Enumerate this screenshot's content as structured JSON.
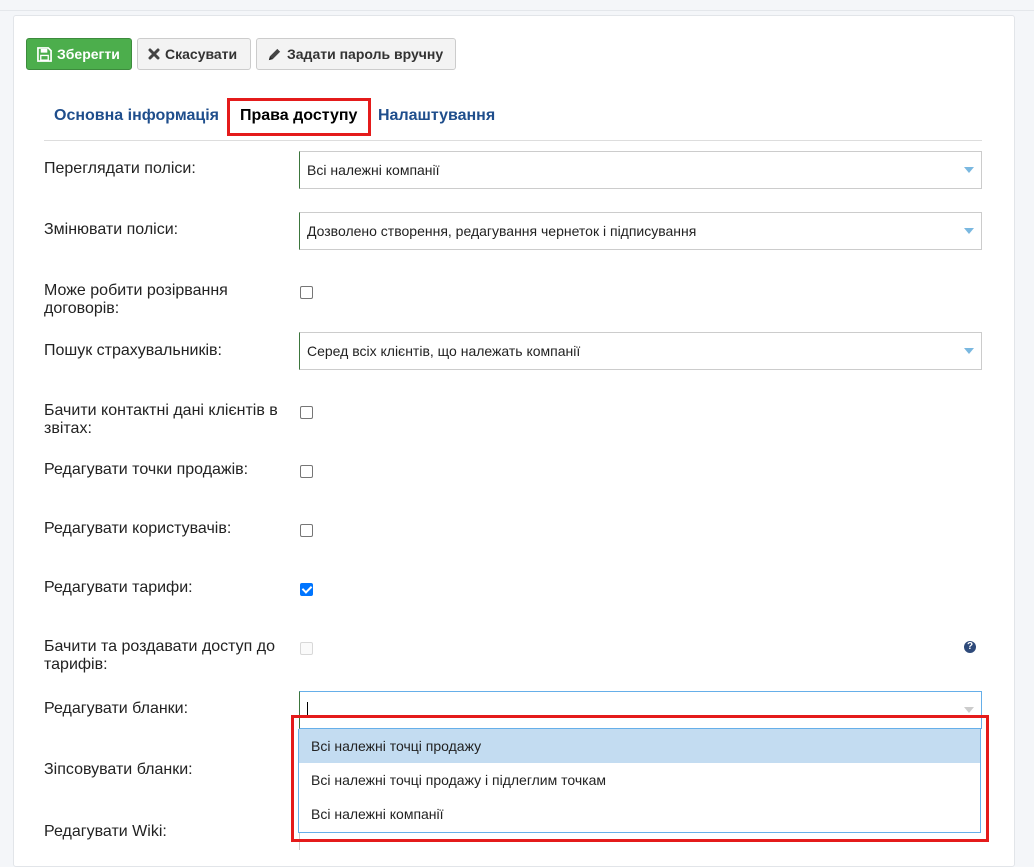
{
  "toolbar": {
    "save_label": "Зберегти",
    "cancel_label": "Скасувати",
    "set_password_label": "Задати пароль вручну"
  },
  "tabs": [
    {
      "label": "Основна інформація",
      "active": false
    },
    {
      "label": "Права доступу",
      "active": true
    },
    {
      "label": "Налаштування",
      "active": false
    }
  ],
  "fields": {
    "view_policies": {
      "label": "Переглядати поліси:",
      "value": "Всі належні компанії"
    },
    "edit_policies": {
      "label": "Змінювати поліси:",
      "value": "Дозволено створення, редагування чернеток і підписування"
    },
    "terminate_contracts": {
      "label": "Може робити розірвання договорів:",
      "checked": false
    },
    "search_insurers": {
      "label": "Пошук страхувальників:",
      "value": "Серед всіх клієнтів, що належать компанії"
    },
    "see_client_contacts": {
      "label": "Бачити контактні дані клієнтів в звітах:",
      "checked": false
    },
    "edit_sale_points": {
      "label": "Редагувати точки продажів:",
      "checked": false
    },
    "edit_users": {
      "label": "Редагувати користувачів:",
      "checked": false
    },
    "edit_tariffs": {
      "label": "Редагувати тарифи:",
      "checked": true
    },
    "share_tariffs": {
      "label": "Бачити та роздавати доступ до тарифів:",
      "checked": false,
      "disabled": true
    },
    "edit_forms": {
      "label": "Редагувати бланки:",
      "value": ""
    },
    "spoil_forms": {
      "label": "Зіпсовувати бланки:"
    },
    "edit_wiki": {
      "label": "Редагувати Wiki:"
    }
  },
  "dropdown_options": [
    "Всі належні точці продажу",
    "Всі належні точці продажу і підлеглим точкам",
    "Всі належні компанії"
  ],
  "help_icon_glyph": "?",
  "colors": {
    "save_green": "#4cae4c",
    "tab_blue": "#1f4e8c",
    "highlight_red": "#e41b1b",
    "option_highlight": "#c3dcf1",
    "checkbox_blue": "#0075ff"
  }
}
